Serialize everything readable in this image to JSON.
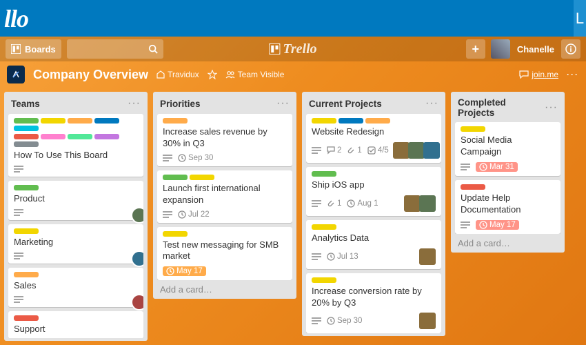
{
  "outer": {
    "logo_fragment": "llo",
    "right_initial": "L"
  },
  "topbar": {
    "boards_label": "Boards",
    "brand": "Trello",
    "user_name": "Chanelle"
  },
  "boardbar": {
    "title": "Company Overview",
    "org": "Travidux",
    "visibility": "Team Visible",
    "link": "join.me"
  },
  "lists": [
    {
      "title": "Teams",
      "cards": [
        {
          "labels": [
            "green",
            "yellow",
            "orange",
            "blue",
            "sky"
          ],
          "labels2": [
            "red",
            "pink",
            "lime",
            "purple",
            "gray"
          ],
          "title": "How To Use This Board",
          "desc": true
        },
        {
          "labels": [
            "green"
          ],
          "title": "Product",
          "desc": true,
          "side_member": true
        },
        {
          "labels": [
            "yellow"
          ],
          "title": "Marketing",
          "desc": true,
          "side_member": true
        },
        {
          "labels": [
            "orange"
          ],
          "title": "Sales",
          "desc": true,
          "side_member": true
        },
        {
          "labels": [
            "red"
          ],
          "title": "Support"
        }
      ]
    },
    {
      "title": "Priorities",
      "cards": [
        {
          "labels": [
            "orange"
          ],
          "title": "Increase sales revenue by 30% in Q3",
          "desc": true,
          "due": "Sep 30"
        },
        {
          "labels": [
            "green",
            "yellow"
          ],
          "title": "Launch first international expansion",
          "desc": true,
          "due": "Jul 22"
        },
        {
          "labels": [
            "yellow"
          ],
          "title": "Test new messaging for SMB market",
          "due": "May 17",
          "due_color": "#ffab4a"
        }
      ],
      "add": "Add a card…"
    },
    {
      "title": "Current Projects",
      "cards": [
        {
          "labels": [
            "yellow",
            "blue",
            "orange"
          ],
          "title": "Website Redesign",
          "desc": true,
          "comments": 2,
          "attach": 1,
          "check": "4/5",
          "members": 3
        },
        {
          "labels": [
            "green"
          ],
          "title": "Ship iOS app",
          "desc": true,
          "due": "Aug 1",
          "attach": 1,
          "members": 2
        },
        {
          "labels": [
            "yellow"
          ],
          "title": "Analytics Data",
          "desc": true,
          "due": "Jul 13",
          "members": 1
        },
        {
          "labels": [
            "yellow"
          ],
          "title": "Increase conversion rate by 20% by Q3",
          "desc": true,
          "due": "Sep 30",
          "members": 1
        }
      ]
    },
    {
      "title": "Completed Projects",
      "cards": [
        {
          "labels": [
            "yellow"
          ],
          "title": "Social Media Campaign",
          "desc": true,
          "due": "Mar 31",
          "due_color": "#ff9488"
        },
        {
          "labels": [
            "red"
          ],
          "title": "Update Help Documentation",
          "desc": true,
          "due": "May 17",
          "due_color": "#ff9488"
        }
      ],
      "add": "Add a card…"
    }
  ]
}
